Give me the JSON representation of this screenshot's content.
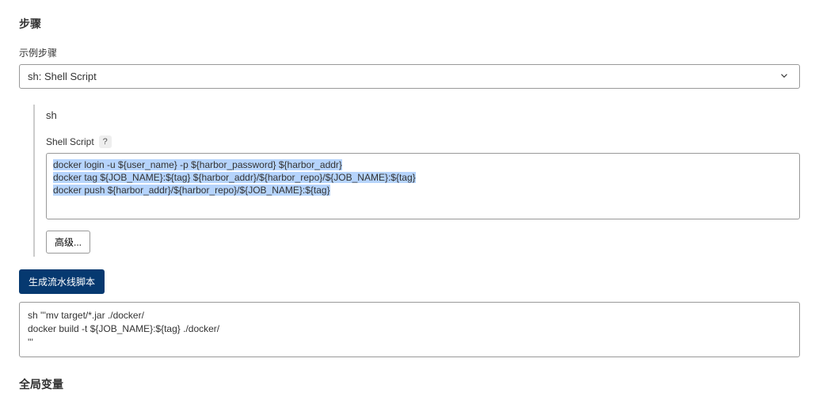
{
  "steps": {
    "title": "步骤",
    "exampleLabel": "示例步骤",
    "selectedStep": "sh: Shell Script"
  },
  "panel": {
    "title": "sh",
    "fieldLabel": "Shell Script",
    "script": {
      "line1": "docker login -u ${user_name} -p ${harbor_password} ${harbor_addr}",
      "line2": "docker tag ${JOB_NAME}:${tag} ${harbor_addr}/${harbor_repo}/${JOB_NAME}:${tag}",
      "line3": "docker push  ${harbor_addr}/${harbor_repo}/${JOB_NAME}:${tag}"
    },
    "advancedLabel": "高级..."
  },
  "generate": {
    "buttonLabel": "生成流水线脚本",
    "output": "sh '''mv target/*.jar ./docker/\ndocker build -t ${JOB_NAME}:${tag} ./docker/\n'''"
  },
  "globals": {
    "title": "全局变量"
  },
  "icons": {
    "help": "?",
    "chevron": "chevron-down-icon"
  }
}
